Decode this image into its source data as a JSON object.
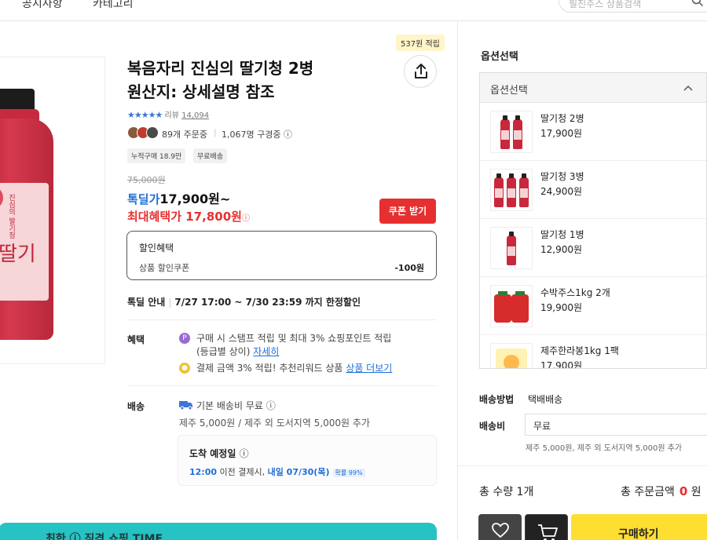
{
  "nav": {
    "notice": "공지사항",
    "category": "카테고리",
    "search_placeholder": "필진주스 상품검색"
  },
  "product_image": {
    "label_main": "딸기",
    "label_sub": "진심의 딸기청"
  },
  "points_badge": "537원 적립",
  "title_line1": "복음자리 진심의 딸기청 2병",
  "title_line2": "원산지: 상세설명 참조",
  "rating": {
    "stars": "★★★★★",
    "review_label": "리뷰",
    "review_count": "14,094"
  },
  "social": {
    "orders": "89개 주문중",
    "viewers": "1,067명 구경중"
  },
  "tags": [
    "누적구매 18.9만",
    "무료배송"
  ],
  "price": {
    "original": "75,000원",
    "deal_label": "톡딜가",
    "deal_value": "17,900원~",
    "max_label": "최대혜택가",
    "max_value": "17,800원"
  },
  "coupon_button": "쿠폰 받기",
  "discount": {
    "title": "할인혜택",
    "row_label": "상품 할인쿠폰",
    "row_amount": "-100원"
  },
  "deal_info": {
    "label": "톡딜 안내",
    "value": "7/27 17:00 ~ 7/30 23:59 까지 한정할인"
  },
  "benefits": {
    "label": "혜택",
    "line1": "구매 시 스탬프 적립 및 최대 3% 쇼핑포인트 적립",
    "line1b": "(등급별 상이)",
    "line1_link": "자세히",
    "line2": "결제 금액 3% 적립! 추천리워드 상품",
    "line2_link": "상품 더보기"
  },
  "shipping": {
    "label": "배송",
    "line1": "기본 배송비 무료",
    "line2": "제주 5,000원 / 제주 외 도서지역 5,000원 추가"
  },
  "arrival": {
    "title": "도착 예정일",
    "time": "12:00",
    "mid": "이전 결제시,",
    "date": "내일 07/30(목)",
    "prob": "확률 99%"
  },
  "banner": "최한 ⓘ 직격 쇼핑 TIME",
  "options": {
    "heading": "옵션선택",
    "dropdown_label": "옵션선택",
    "items": [
      {
        "name": "딸기청 2병",
        "price": "17,900원"
      },
      {
        "name": "딸기청 3병",
        "price": "24,900원"
      },
      {
        "name": "딸기청 1병",
        "price": "12,900원"
      },
      {
        "name": "수박주스1kg 2개",
        "price": "19,900원"
      },
      {
        "name": "제주한라봉1kg 1팩",
        "price": "17,900원"
      }
    ]
  },
  "ship_method": {
    "label": "배송방법",
    "value": "택배배송"
  },
  "ship_fee": {
    "label": "배송비",
    "value": "무료",
    "note": "제주 5,000원, 제주 외 도서지역 5,000원 추가"
  },
  "totals": {
    "qty_label": "총 수량",
    "qty_value": "1개",
    "amount_label": "총 주문금액",
    "amount_value": "0",
    "amount_unit": "원"
  },
  "buy_button": "구매하기",
  "colors": {
    "accent_red": "#e5302f",
    "accent_blue": "#1f6fd6",
    "buy_yellow": "#ffde32"
  }
}
